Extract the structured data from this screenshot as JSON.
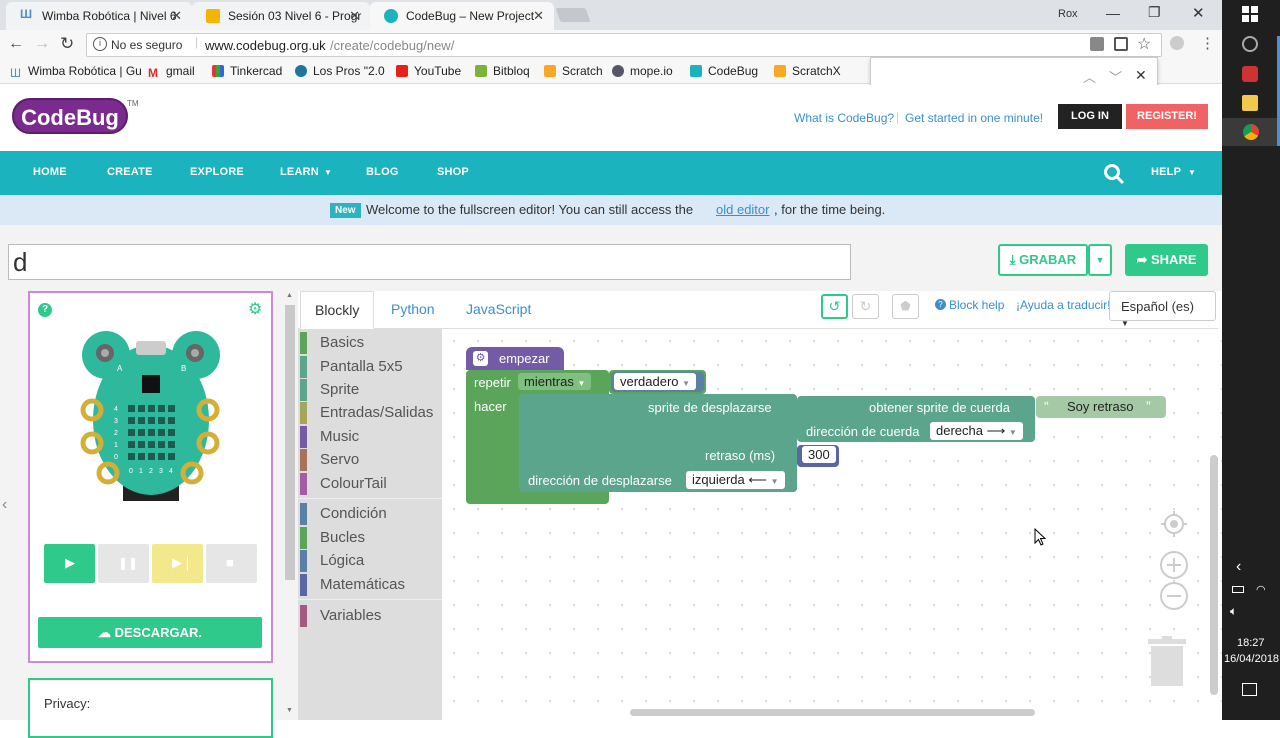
{
  "browser": {
    "tabs": [
      {
        "label": "Wimba Robótica | Nivel 6",
        "fav": "#4a90d9"
      },
      {
        "label": "Sesión 03 Nivel 6 - Progr",
        "fav": "#f4b400"
      },
      {
        "label": "CodeBug – New Project",
        "fav": "#1bb3bd"
      }
    ],
    "user": "Rox",
    "security": "No es seguro",
    "url_host": "www.codebug.org.uk",
    "url_path": "/create/codebug/new/",
    "bookmarks": [
      "Wimba Robótica | Gu",
      "gmail",
      "Tinkercad",
      "Los Pros \"2.0",
      "YouTube",
      "Bitbloq",
      "Scratch",
      "mope.io",
      "CodeBug",
      "ScratchX"
    ]
  },
  "site": {
    "logo": "CodeBug",
    "tm": "TM",
    "what_is": "What is CodeBug?",
    "get_started": "Get started in one minute!",
    "login": "LOG IN",
    "register": "REGISTER!",
    "nav": [
      "HOME",
      "CREATE",
      "EXPLORE",
      "LEARN",
      "BLOG",
      "SHOP"
    ],
    "help": "HELP",
    "banner_badge": "New",
    "banner_text": "Welcome to the fullscreen editor! You can still access the",
    "banner_link": "old editor",
    "banner_tail": ", for the time being."
  },
  "project": {
    "title": "d",
    "grabar": "GRABAR",
    "share": "SHARE",
    "descargar": "DESCARGAR.",
    "privacy": "Privacy:",
    "pad_a": "A",
    "pad_b": "B",
    "rows": [
      "4",
      "3",
      "2",
      "1",
      "0"
    ],
    "cols": [
      "0",
      "1",
      "2",
      "3",
      "4"
    ]
  },
  "editor": {
    "tabs": [
      "Blockly",
      "Python",
      "JavaScript"
    ],
    "block_help": "Block help",
    "translate": "¡Ayuda a traducir!",
    "language": "Español (es)",
    "categories": [
      {
        "label": "Basics",
        "color": "#5ba55b"
      },
      {
        "label": "Pantalla 5x5",
        "color": "#5ba58c"
      },
      {
        "label": "Sprite",
        "color": "#5ba58c"
      },
      {
        "label": "Entradas/Salidas",
        "color": "#a5a55b"
      },
      {
        "label": "Music",
        "color": "#745ba5"
      },
      {
        "label": "Servo",
        "color": "#a5745b"
      },
      {
        "label": "ColourTail",
        "color": "#a55ba5"
      },
      {
        "label": "Condición",
        "color": "#5b80a5"
      },
      {
        "label": "Bucles",
        "color": "#5ba55b"
      },
      {
        "label": "Lógica",
        "color": "#5b80a5"
      },
      {
        "label": "Matemáticas",
        "color": "#5b67a5"
      },
      {
        "label": "Variables",
        "color": "#a55b80"
      }
    ]
  },
  "blocks": {
    "start": "empezar",
    "repeat": "repetir",
    "while": "mientras",
    "true": "verdadero",
    "do": "hacer",
    "scroll_sprite": "sprite de desplazarse",
    "get_sprite": "obtener sprite de cuerda",
    "string": "Soy retraso",
    "string_dir": "dirección de cuerda",
    "right": "derecha ⟶",
    "delay": "retraso (ms)",
    "delay_val": "300",
    "scroll_dir": "dirección de desplazarse",
    "left": "izquierda ⟵"
  },
  "taskbar": {
    "time": "18:27",
    "date": "16/04/2018"
  }
}
